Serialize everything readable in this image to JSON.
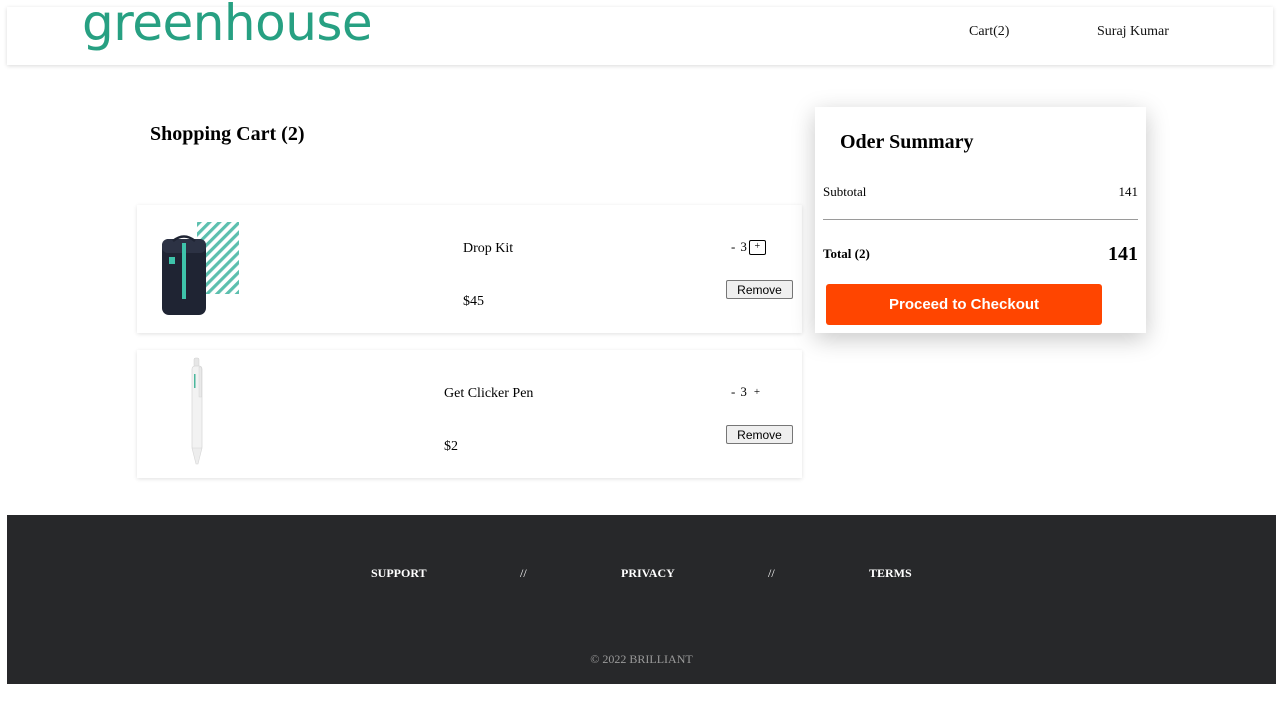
{
  "header": {
    "logo_text": "greenhouse",
    "cart_link": "Cart(2)",
    "user_name": "Suraj Kumar"
  },
  "cart": {
    "title": "Shopping Cart (2)",
    "items": [
      {
        "name": "Drop Kit",
        "price": "$45",
        "qty_minus": "-",
        "qty": "3",
        "qty_plus": "+",
        "remove_label": "Remove",
        "image": "drop-kit-bag"
      },
      {
        "name": "Get Clicker Pen",
        "price": "$2",
        "qty_minus": "-",
        "qty": "3",
        "qty_plus": "+",
        "remove_label": "Remove",
        "image": "clicker-pen"
      }
    ]
  },
  "summary": {
    "title": "Oder Summary",
    "subtotal_label": "Subtotal",
    "subtotal_value": "141",
    "total_label": "Total (2)",
    "total_value": "141",
    "checkout_label": "Proceed to Checkout"
  },
  "footer": {
    "links": [
      "SUPPORT",
      "PRIVACY",
      "TERMS"
    ],
    "separator": "//",
    "copyright": "© 2022 BRILLIANT"
  },
  "colors": {
    "brand_green": "#27a082",
    "checkout_orange": "#ff4500",
    "footer_bg": "#27282a"
  }
}
